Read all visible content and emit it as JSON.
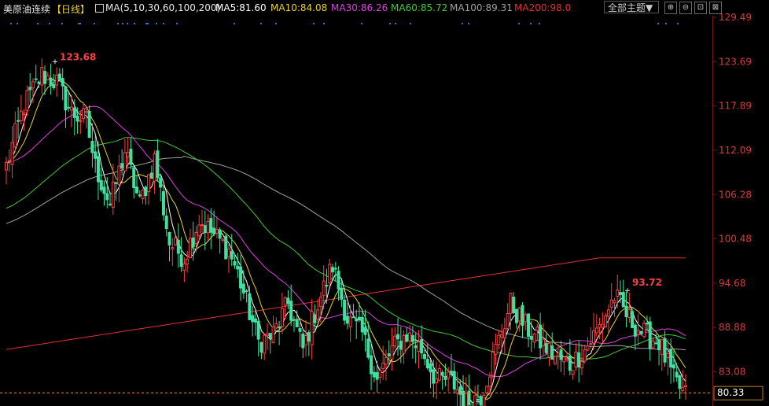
{
  "header": {
    "title": "美原油连续",
    "period": "【日线】",
    "ma_label": "MA(5,10,30,60,100,200)",
    "ma5": "MA5:81.60",
    "ma10": "MA10:84.08",
    "ma30": "MA30:86.26",
    "ma60": "MA60:85.72",
    "ma100": "MA100:89.31",
    "ma200": "MA200:98.0",
    "theme_select": "全部主题▼",
    "btn_zoom_in": "⊕",
    "btn_zoom_out": "⊖",
    "btn_restore": "⊡",
    "btn_close": "⊠"
  },
  "colors": {
    "ma5": "#ffffff",
    "ma10": "#e8d21d",
    "ma30": "#e040e0",
    "ma60": "#3fc83f",
    "ma100": "#a0a0a0",
    "ma200": "#e23030",
    "up": "#ff4040",
    "down": "#40e0a0"
  },
  "chart_data": {
    "type": "candlestick",
    "y_ticks": [
      "129.49",
      "123.69",
      "117.89",
      "112.09",
      "106.28",
      "100.48",
      "94.68",
      "88.88",
      "83.08"
    ],
    "ylim": [
      78.5,
      131.0
    ],
    "high_label": "123.68",
    "high_value": 123.68,
    "local_high_label": "93.72",
    "local_high_value": 93.72,
    "last_price": "80.33",
    "last_value": 80.33,
    "series_ma_names": [
      "MA5",
      "MA10",
      "MA30",
      "MA60",
      "MA100",
      "MA200"
    ]
  }
}
